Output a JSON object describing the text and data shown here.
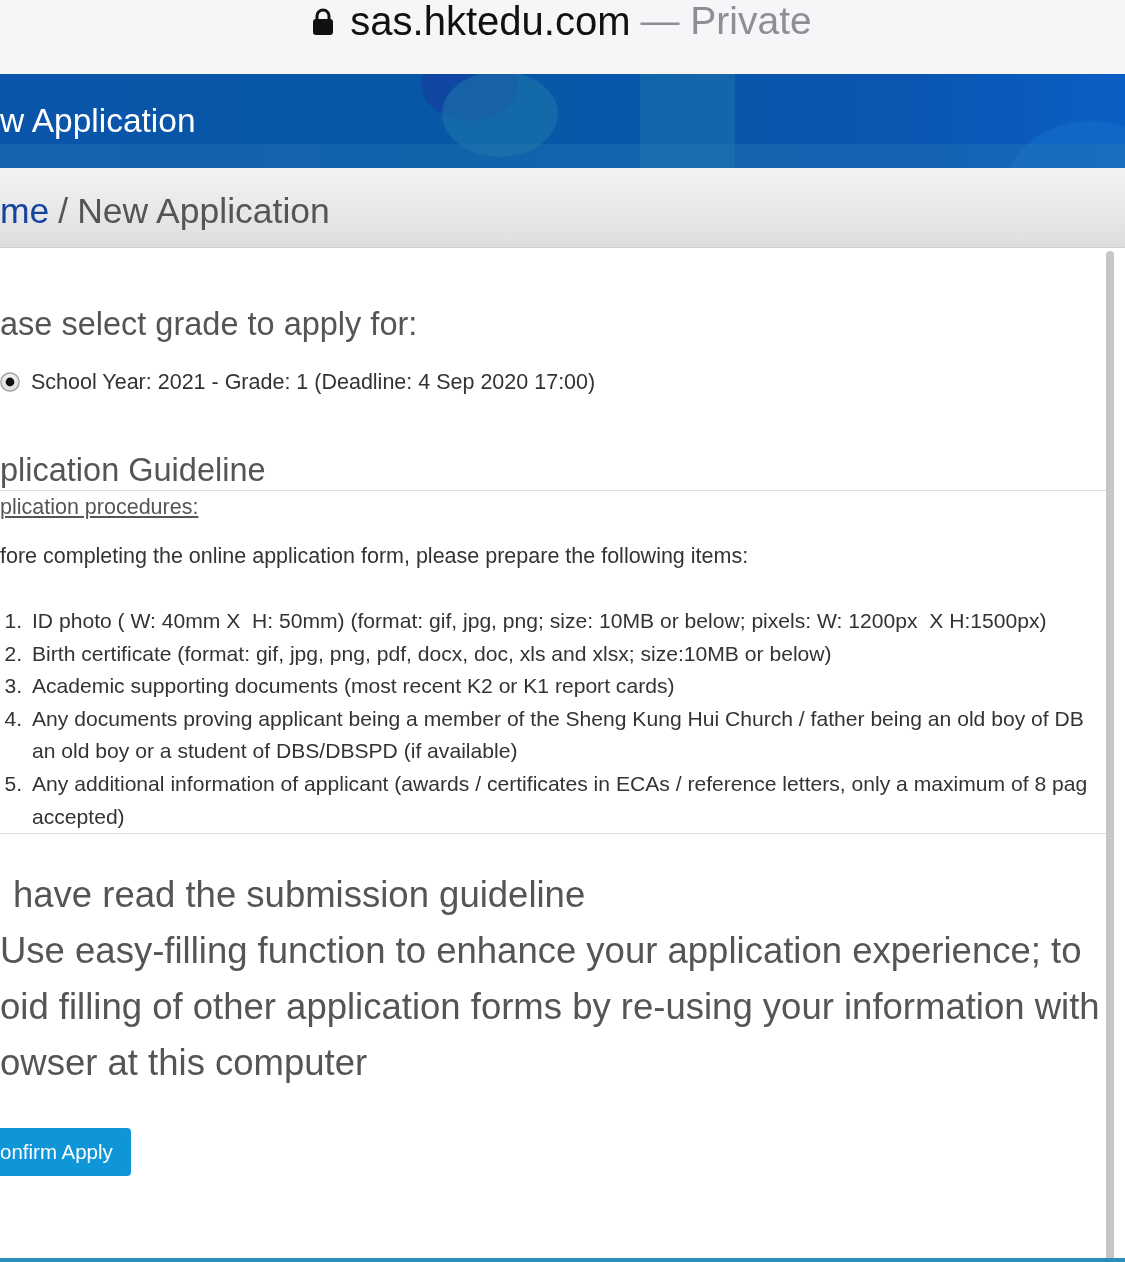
{
  "address_bar": {
    "domain": "sas.hktedu.com",
    "mode": "— Private"
  },
  "banner": {
    "title": "w Application"
  },
  "breadcrumb": {
    "link": "me",
    "separator": "/",
    "current": "New Application"
  },
  "grade_selection": {
    "heading": "ase select grade to apply for:",
    "options": [
      {
        "label": "School Year: 2021 - Grade: 1 (Deadline: 4 Sep 2020 17:00)",
        "selected": true
      }
    ]
  },
  "guideline": {
    "heading": "plication Guideline",
    "procedures_link": "plication procedures:",
    "intro": "fore completing the online application form, please prepare the following items:",
    "items": [
      {
        "number": "1.",
        "lines": [
          "ID photo ( W: 40mm X  H: 50mm) (format: gif, jpg, png; size: 10MB or below; pixels: W: 1200px  X H:1500px)"
        ]
      },
      {
        "number": "2.",
        "lines": [
          "Birth certificate (format: gif, jpg, png, pdf, docx, doc, xls and xlsx; size:10MB or below)"
        ]
      },
      {
        "number": "3.",
        "lines": [
          "Academic supporting documents (most recent K2 or K1 report cards)"
        ]
      },
      {
        "number": "4.",
        "lines": [
          "Any documents proving applicant being a member of the Sheng Kung Hui Church / father being an old boy of DB",
          "an old boy or a student of DBS/DBSPD (if available)"
        ]
      },
      {
        "number": "5.",
        "lines": [
          "Any additional information of applicant (awards / certificates in ECAs / reference letters, only a maximum of 8 pag",
          "accepted)"
        ]
      }
    ]
  },
  "declarations": [
    {
      "lines": [
        "have read the submission guideline"
      ]
    },
    {
      "lines": [
        "Use easy-filling function to enhance your application experience; to",
        "oid filling of other application forms by re-using your information with",
        "owser at this computer"
      ]
    }
  ],
  "confirm_button": {
    "label": "onfirm Apply"
  }
}
